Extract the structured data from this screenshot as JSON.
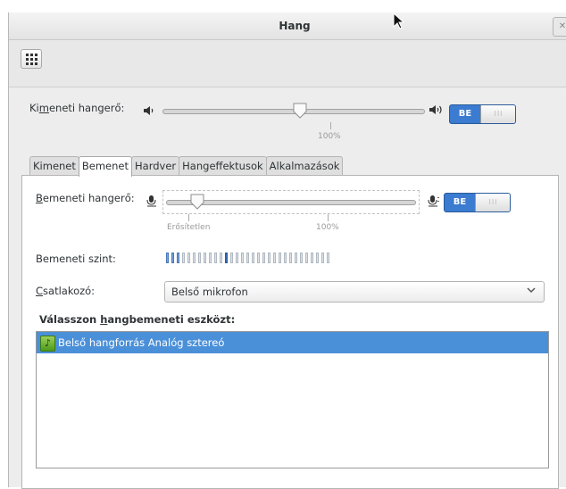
{
  "window": {
    "title": "Hang"
  },
  "output": {
    "label_pre": "Ki",
    "label_underlined": "m",
    "label_post": "eneti hangerő:",
    "volume_percent": 100,
    "tick_100": "100%",
    "switch_on": "BE",
    "switch_knob": "III"
  },
  "tabs": [
    {
      "label": "Kimenet"
    },
    {
      "label": "Bemenet"
    },
    {
      "label": "Hardver"
    },
    {
      "label": "Hangeffektusok"
    },
    {
      "label": "Alkalmazások"
    }
  ],
  "active_tab": 1,
  "input": {
    "volume_label_underlined": "B",
    "volume_label_rest": "emeneti hangerő:",
    "tick_unamplified": "Erősítetlen",
    "tick_100": "100%",
    "switch_on": "BE",
    "switch_knob": "III",
    "level_label": "Bemeneti szint:",
    "level_total_segments": 31,
    "level_lit_segments": 3,
    "level_peak_index": 11,
    "connector_label_underlined": "C",
    "connector_label_rest": "satlakozó:",
    "connector_value": "Belső mikrofon",
    "device_heading_pre": "Válasszon ",
    "device_heading_underlined": "h",
    "device_heading_post": "angbemeneti eszközt:",
    "devices": [
      {
        "name": "Belső hangforrás Analóg sztereó",
        "selected": true,
        "icon": "audio-card-icon"
      }
    ]
  },
  "icons": {
    "appmenu": "grid-menu-icon",
    "speaker_low": "speaker-low-icon",
    "speaker_high": "speaker-high-icon",
    "mic_low": "microphone-low-icon",
    "mic_high": "microphone-high-icon",
    "combo_arrow": "chevron-down-icon",
    "window_close": "close-icon"
  },
  "colors": {
    "accent": "#3b7bd0",
    "selection": "#4a90d9",
    "level_lit": "#7aa3d8"
  }
}
